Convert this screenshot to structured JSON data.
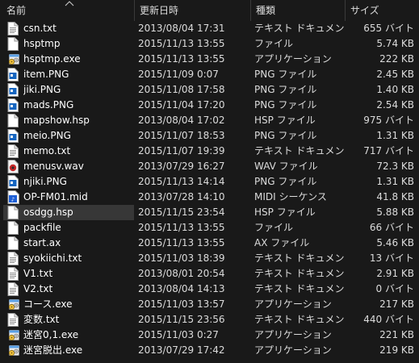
{
  "columns": {
    "name": "名前",
    "modified": "更新日時",
    "type": "種類",
    "size": "サイズ"
  },
  "files": [
    {
      "name": "csn.txt",
      "modified": "2013/08/04 17:31",
      "type": "テキスト ドキュメント",
      "size": "655 バイト",
      "icon": "text-document-icon"
    },
    {
      "name": "hsptmp",
      "modified": "2015/11/13 13:55",
      "type": "ファイル",
      "size": "5.74 KB",
      "icon": "file-icon"
    },
    {
      "name": "hsptmp.exe",
      "modified": "2015/11/13 13:55",
      "type": "アプリケーション",
      "size": "222 KB",
      "icon": "application-icon"
    },
    {
      "name": "item.PNG",
      "modified": "2015/11/09 0:07",
      "type": "PNG ファイル",
      "size": "2.45 KB",
      "icon": "image-file-icon"
    },
    {
      "name": "jiki.PNG",
      "modified": "2015/11/08 17:58",
      "type": "PNG ファイル",
      "size": "1.40 KB",
      "icon": "image-file-icon"
    },
    {
      "name": "mads.PNG",
      "modified": "2015/11/04 17:20",
      "type": "PNG ファイル",
      "size": "2.54 KB",
      "icon": "image-file-icon"
    },
    {
      "name": "mapshow.hsp",
      "modified": "2013/08/04 17:02",
      "type": "HSP ファイル",
      "size": "975 バイト",
      "icon": "file-icon"
    },
    {
      "name": "meio.PNG",
      "modified": "2015/11/07 18:53",
      "type": "PNG ファイル",
      "size": "1.31 KB",
      "icon": "image-file-icon"
    },
    {
      "name": "memo.txt",
      "modified": "2015/11/07 19:39",
      "type": "テキスト ドキュメント",
      "size": "717 バイト",
      "icon": "text-document-icon"
    },
    {
      "name": "menusv.wav",
      "modified": "2013/07/29 16:27",
      "type": "WAV ファイル",
      "size": "72.3 KB",
      "icon": "audio-file-icon"
    },
    {
      "name": "njiki.PNG",
      "modified": "2015/11/13 14:14",
      "type": "PNG ファイル",
      "size": "1.31 KB",
      "icon": "image-file-icon"
    },
    {
      "name": "OP-FM01.mid",
      "modified": "2013/07/28 14:10",
      "type": "MIDI シーケンス",
      "size": "41.8 KB",
      "icon": "midi-file-icon"
    },
    {
      "name": "osdgg.hsp",
      "modified": "2015/11/15 23:54",
      "type": "HSP ファイル",
      "size": "5.88 KB",
      "icon": "file-icon",
      "selected": true
    },
    {
      "name": "packfile",
      "modified": "2015/11/13 13:55",
      "type": "ファイル",
      "size": "66 バイト",
      "icon": "file-icon"
    },
    {
      "name": "start.ax",
      "modified": "2015/11/13 13:55",
      "type": "AX ファイル",
      "size": "5.46 KB",
      "icon": "file-icon"
    },
    {
      "name": "syokiichi.txt",
      "modified": "2015/11/03 18:39",
      "type": "テキスト ドキュメント",
      "size": "13 バイト",
      "icon": "text-document-icon"
    },
    {
      "name": "V1.txt",
      "modified": "2013/08/01 20:54",
      "type": "テキスト ドキュメント",
      "size": "2.91 KB",
      "icon": "text-document-icon"
    },
    {
      "name": "V2.txt",
      "modified": "2013/08/04 14:13",
      "type": "テキスト ドキュメント",
      "size": "0 バイト",
      "icon": "text-document-icon"
    },
    {
      "name": "コース.exe",
      "modified": "2015/11/03 13:57",
      "type": "アプリケーション",
      "size": "217 KB",
      "icon": "application-icon"
    },
    {
      "name": "変数.txt",
      "modified": "2015/11/15 23:56",
      "type": "テキスト ドキュメント",
      "size": "440 バイト",
      "icon": "text-document-icon"
    },
    {
      "name": "迷宮0,1.exe",
      "modified": "2015/11/03 0:27",
      "type": "アプリケーション",
      "size": "221 KB",
      "icon": "application-icon"
    },
    {
      "name": "迷宮脱出.exe",
      "modified": "2013/07/29 17:42",
      "type": "アプリケーション",
      "size": "219 KB",
      "icon": "application-icon"
    }
  ],
  "colors": {
    "background": "#191919",
    "selection": "#373737",
    "text": "#ffffff",
    "secondary_text": "#dcdcdc",
    "image_icon_blue": "#1565c0",
    "midi_icon_blue": "#1e5fd6",
    "audio_icon_red": "#c62828"
  }
}
